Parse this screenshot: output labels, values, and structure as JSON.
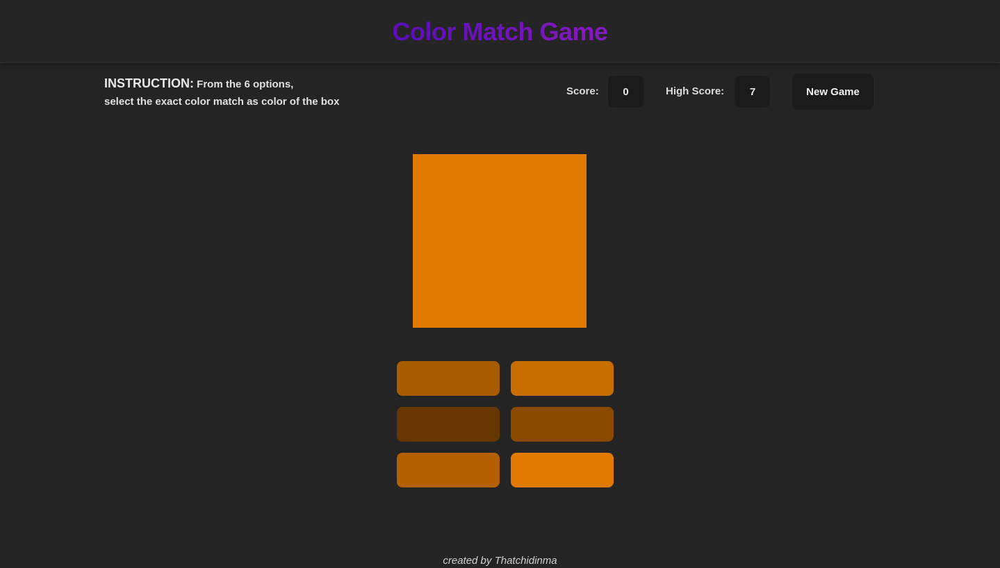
{
  "header": {
    "title_words": [
      "Color",
      "Match",
      "Game"
    ]
  },
  "instruction": {
    "lead": "INSTRUCTION:",
    "line1": "From the 6 options,",
    "line2": "select the exact color match as color of the box"
  },
  "stats": {
    "score_label": "Score:",
    "score_value": "0",
    "high_score_label": "High Score:",
    "high_score_value": "7"
  },
  "actions": {
    "new_game_label": "New Game"
  },
  "game": {
    "target_color": "#e07a00",
    "options": [
      {
        "color": "#a85c00"
      },
      {
        "color": "#c86d00"
      },
      {
        "color": "#663700"
      },
      {
        "color": "#894a00"
      },
      {
        "color": "#b36100"
      },
      {
        "color": "#e07a00"
      }
    ]
  },
  "footer": {
    "credit": "created by Thatchidinma"
  },
  "colors": {
    "background": "#242424",
    "panel": "#1b1b1b",
    "title_gradient": [
      "#3c0cf0",
      "#5a0fb8",
      "#9a1fc0",
      "#f06ae8"
    ]
  }
}
